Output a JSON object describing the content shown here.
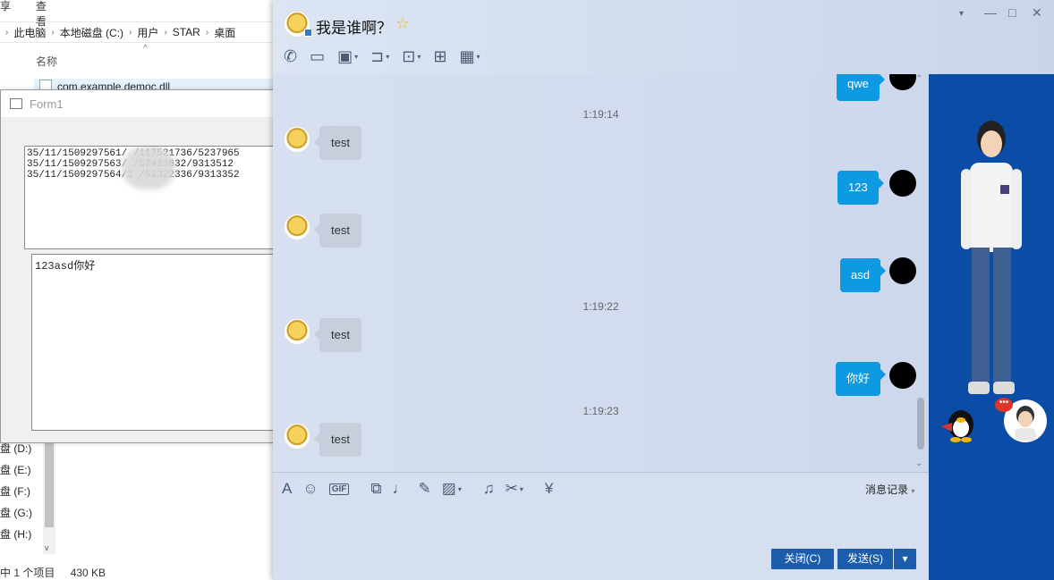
{
  "explorer": {
    "ribbon": [
      "享",
      "查看"
    ],
    "breadcrumb": [
      "此电脑",
      "本地磁盘 (C:)",
      "用户",
      "STAR",
      "桌面"
    ],
    "column_name": "名称",
    "file_name": "com.example.democ.dll",
    "drives": [
      "盘 (D:)",
      "盘 (E:)",
      "盘 (F:)",
      "盘 (G:)",
      "盘 (H:)"
    ],
    "status_selected": "中 1 个项目",
    "status_size": "430 KB"
  },
  "form1": {
    "title": "Form1",
    "list_items": [
      "35/11/1509297561/           /117521736/5237965",
      "35/11/1509297563/           /52423632/9313512",
      "35/11/1509297564/1          /52322336/9313352"
    ],
    "textbox_value": "123asd你好"
  },
  "qq": {
    "contact_name": "我是谁啊？",
    "icons": {
      "toolbar": [
        "phone-icon",
        "video-icon",
        "screen-share-icon",
        "file-transfer-icon",
        "remote-desktop-icon",
        "add-chat-icon",
        "apps-icon"
      ],
      "input": [
        "font-icon",
        "emoji-icon",
        "gif-icon",
        "shake-icon",
        "voice-icon",
        "doodle-icon",
        "image-icon",
        "music-icon",
        "screenshot-icon",
        "red-packet-icon"
      ]
    },
    "gif_label": "GIF",
    "messages": [
      {
        "type": "out",
        "text": "qwe"
      },
      {
        "type": "time",
        "text": "1:19:14"
      },
      {
        "type": "in",
        "text": "test"
      },
      {
        "type": "out",
        "text": "123"
      },
      {
        "type": "in",
        "text": "test"
      },
      {
        "type": "out",
        "text": "asd"
      },
      {
        "type": "time",
        "text": "1:19:22"
      },
      {
        "type": "in",
        "text": "test"
      },
      {
        "type": "out",
        "text": "你好"
      },
      {
        "type": "time",
        "text": "1:19:23"
      },
      {
        "type": "in",
        "text": "test"
      }
    ],
    "history_label": "消息记录",
    "close_button": "关闭(C)",
    "send_button": "发送(S)"
  },
  "colors": {
    "out_bubble": "#0e9ae3",
    "in_bubble": "#c8cfdc",
    "button_blue": "#1c5dab",
    "right_panel": "#0b4da6"
  }
}
